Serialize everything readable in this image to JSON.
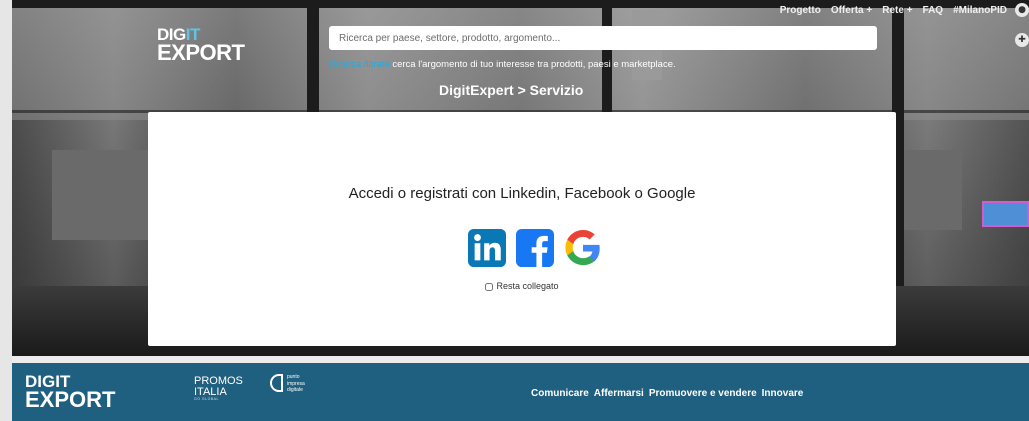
{
  "header": {
    "logo": {
      "line1_a": "DIG",
      "line1_b": "IT",
      "line2": "EXPORT"
    },
    "search": {
      "placeholder": "Ricerca per paese, settore, prodotto, argomento..."
    },
    "hint": {
      "link": "Ricerca filtrata",
      "text": "cerca l'argomento di tuo interesse tra prodotti, paesi e marketplace."
    },
    "breadcrumb": "DigitExpert > Servizio",
    "nav": [
      "Progetto",
      "Offerta +",
      "Rete +",
      "FAQ",
      "#MilanoPID"
    ]
  },
  "login_card": {
    "title": "Accedi o registrati con Linkedin, Facebook o Google",
    "providers": [
      "linkedin-icon",
      "facebook-icon",
      "google-icon"
    ],
    "remember_label": "Resta collegato",
    "remember_checked": false
  },
  "footer": {
    "logo": {
      "line1": "DIGIT",
      "line2": "EXPORT"
    },
    "promos": {
      "line1": "PROMOS",
      "line2": "ITALIA",
      "line3": "GO GLOBAL"
    },
    "pid": {
      "line1": "punto",
      "line2": "impresa",
      "line3": "digitale"
    },
    "nav": [
      "Comunicare",
      "Affermarsi",
      "Promuovere e vendere",
      "Innovare"
    ]
  },
  "colors": {
    "footer_bg": "#1f5f7f",
    "linkedin": "#0a78b5",
    "facebook": "#1877f2",
    "link_blue": "#29a9dc",
    "side_tab": "#4f8fd6",
    "side_tab_border": "#d15bd1"
  }
}
